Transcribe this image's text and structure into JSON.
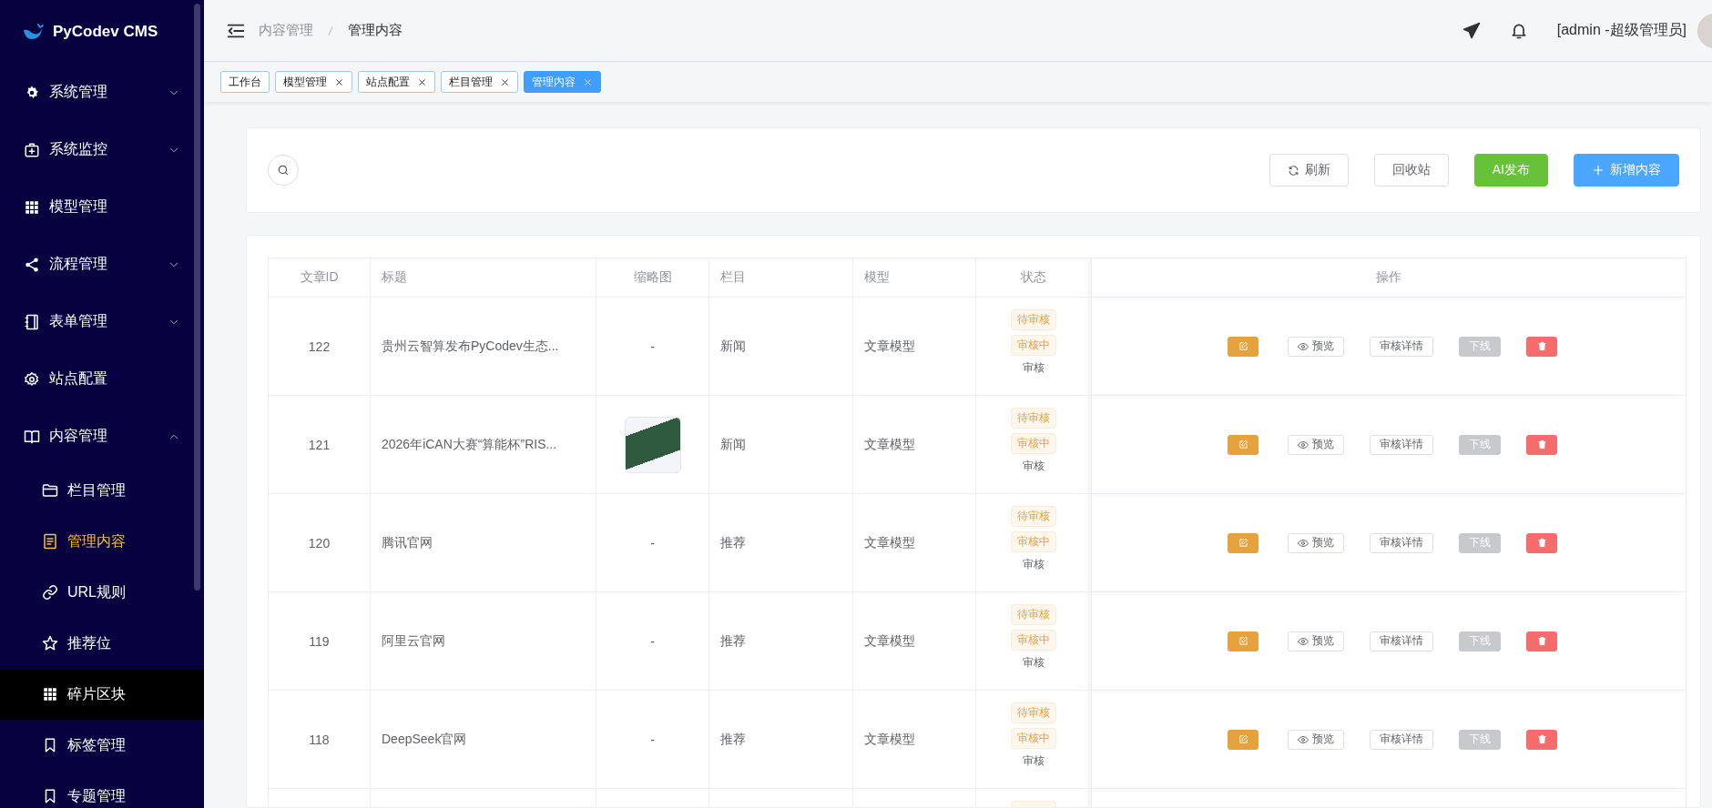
{
  "sidebar": {
    "logo": "PyCodev CMS",
    "items": [
      {
        "label": "系统管理",
        "selected": false,
        "expanded": false
      },
      {
        "label": "系统监控",
        "selected": false,
        "expanded": false
      },
      {
        "label": "模型管理",
        "selected": false
      },
      {
        "label": "流程管理",
        "selected": false,
        "expanded": false
      },
      {
        "label": "表单管理",
        "selected": false,
        "expanded": false
      },
      {
        "label": "站点配置",
        "selected": false
      },
      {
        "label": "内容管理",
        "selected": false,
        "expanded": true,
        "children": [
          {
            "label": "栏目管理",
            "selected": false,
            "highlighted": false
          },
          {
            "label": "管理内容",
            "selected": true,
            "highlighted": false
          },
          {
            "label": "URL规则",
            "selected": false,
            "highlighted": false
          },
          {
            "label": "推荐位",
            "selected": false,
            "highlighted": false
          },
          {
            "label": "碎片区块",
            "selected": false,
            "highlighted": true
          },
          {
            "label": "标签管理",
            "selected": false,
            "highlighted": false
          },
          {
            "label": "专题管理",
            "selected": false,
            "highlighted": false
          }
        ]
      }
    ]
  },
  "header": {
    "breadcrumb": [
      "内容管理",
      "管理内容"
    ],
    "user": "[admin -超级管理员]"
  },
  "tabs": [
    {
      "label": "工作台",
      "selected": false,
      "closable": false
    },
    {
      "label": "模型管理",
      "selected": false,
      "closable": true
    },
    {
      "label": "站点配置",
      "selected": false,
      "closable": true
    },
    {
      "label": "栏目管理",
      "selected": false,
      "closable": true
    },
    {
      "label": "管理内容",
      "selected": true,
      "closable": true
    }
  ],
  "toolbar": {
    "buttons": [
      {
        "label": "刷新",
        "kind": "refresh"
      },
      {
        "label": "回收站",
        "kind": "default"
      },
      {
        "label": "AI发布",
        "kind": "success"
      },
      {
        "label": "新增内容",
        "kind": "add"
      }
    ]
  },
  "table": {
    "columns": [
      "文章ID",
      "标题",
      "缩略图",
      "栏目",
      "模型",
      "状态",
      "操作"
    ],
    "rows": [
      {
        "id": "122",
        "title": "贵州云智算发布PyCodev生态...",
        "thumbnail": "-",
        "channel": "新闻",
        "model": "文章模型",
        "status": [
          {
            "label": "待审核",
            "kind": "tag"
          },
          {
            "label": "审核中",
            "kind": "tag"
          },
          {
            "label": "审核",
            "kind": "link"
          }
        ],
        "actions": [
          {
            "kind": "edit"
          },
          {
            "kind": "preview",
            "label": "预览"
          },
          {
            "kind": "detail",
            "label": "审核详情"
          },
          {
            "kind": "offline",
            "label": "下线",
            "disabled": true
          },
          {
            "kind": "delete"
          }
        ]
      },
      {
        "id": "121",
        "title": "2026年iCAN大赛“算能杯”RIS...",
        "has_image": true,
        "channel": "新闻",
        "model": "文章模型",
        "status": [
          {
            "label": "待审核",
            "kind": "tag"
          },
          {
            "label": "审核中",
            "kind": "tag"
          },
          {
            "label": "审核",
            "kind": "link"
          }
        ],
        "actions": [
          {
            "kind": "edit"
          },
          {
            "kind": "preview",
            "label": "预览"
          },
          {
            "kind": "detail",
            "label": "审核详情"
          },
          {
            "kind": "offline",
            "label": "下线",
            "disabled": true
          },
          {
            "kind": "delete"
          }
        ]
      },
      {
        "id": "120",
        "title": "腾讯官网",
        "thumbnail": "-",
        "channel": "推荐",
        "model": "文章模型",
        "status": [
          {
            "label": "待审核",
            "kind": "tag"
          },
          {
            "label": "审核中",
            "kind": "tag"
          },
          {
            "label": "审核",
            "kind": "link"
          }
        ],
        "actions": [
          {
            "kind": "edit"
          },
          {
            "kind": "preview",
            "label": "预览"
          },
          {
            "kind": "detail",
            "label": "审核详情"
          },
          {
            "kind": "offline",
            "label": "下线",
            "disabled": true
          },
          {
            "kind": "delete"
          }
        ]
      },
      {
        "id": "119",
        "title": "阿里云官网",
        "thumbnail": "-",
        "channel": "推荐",
        "model": "文章模型",
        "status": [
          {
            "label": "待审核",
            "kind": "tag"
          },
          {
            "label": "审核中",
            "kind": "tag"
          },
          {
            "label": "审核",
            "kind": "link"
          }
        ],
        "actions": [
          {
            "kind": "edit"
          },
          {
            "kind": "preview",
            "label": "预览"
          },
          {
            "kind": "detail",
            "label": "审核详情"
          },
          {
            "kind": "offline",
            "label": "下线",
            "disabled": true
          },
          {
            "kind": "delete"
          }
        ]
      },
      {
        "id": "118",
        "title": "DeepSeek官网",
        "thumbnail": "-",
        "channel": "推荐",
        "model": "文章模型",
        "status": [
          {
            "label": "待审核",
            "kind": "tag"
          },
          {
            "label": "审核中",
            "kind": "tag"
          },
          {
            "label": "审核",
            "kind": "link"
          }
        ],
        "actions": [
          {
            "kind": "edit"
          },
          {
            "kind": "preview",
            "label": "预览"
          },
          {
            "kind": "detail",
            "label": "审核详情"
          },
          {
            "kind": "offline",
            "label": "下线",
            "disabled": true
          },
          {
            "kind": "delete"
          }
        ]
      },
      {
        "status": [
          {
            "kind": "tag"
          }
        ]
      }
    ]
  }
}
